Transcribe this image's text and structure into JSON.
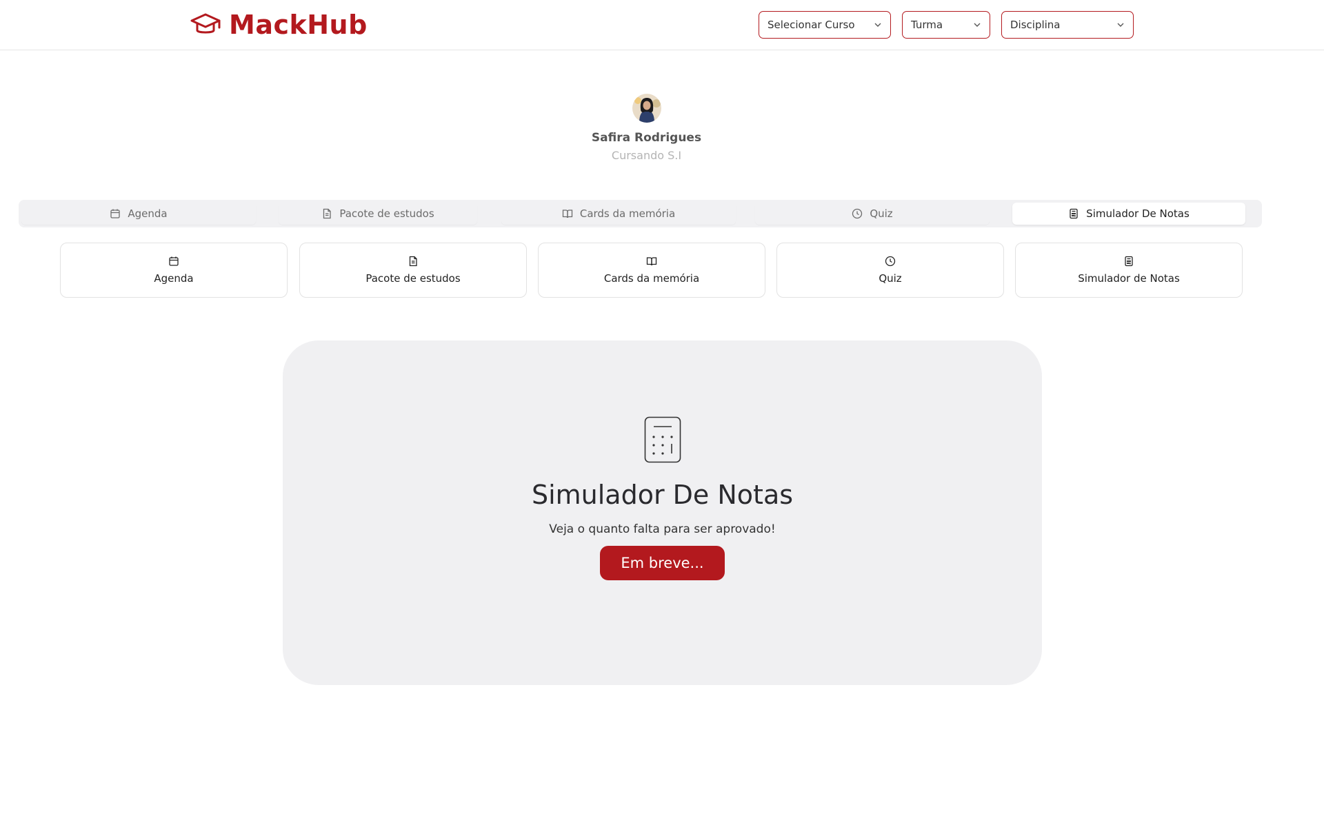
{
  "header": {
    "brand_name": "MackHub",
    "brand_icon": "graduation-cap-icon",
    "selects": {
      "curso": "Selecionar Curso",
      "turma": "Turma",
      "disciplina": "Disciplina"
    }
  },
  "profile": {
    "name": "Safira Rodrigues",
    "subtitle": "Cursando S.I"
  },
  "tabs": [
    {
      "label": "Agenda",
      "icon": "calendar-icon"
    },
    {
      "label": "Pacote de estudos",
      "icon": "document-icon"
    },
    {
      "label": "Cards da memória",
      "icon": "book-open-icon"
    },
    {
      "label": "Quiz",
      "icon": "clock-icon"
    },
    {
      "label": "Simulador De Notas",
      "icon": "calculator-icon",
      "active": true
    }
  ],
  "cards": [
    {
      "label": "Agenda",
      "icon": "calendar-icon"
    },
    {
      "label": "Pacote de estudos",
      "icon": "document-icon"
    },
    {
      "label": "Cards da memória",
      "icon": "book-open-icon"
    },
    {
      "label": "Quiz",
      "icon": "clock-icon"
    },
    {
      "label": "Simulador de Notas",
      "icon": "calculator-icon"
    }
  ],
  "panel": {
    "icon": "calculator-icon",
    "title": "Simulador De Notas",
    "subtitle": "Veja o quanto falta para ser aprovado!",
    "button": "Em breve..."
  },
  "colors": {
    "brand": "#b3191e",
    "panel_bg": "#f0f0f2",
    "tab_bar_bg": "#f1f1f3"
  }
}
